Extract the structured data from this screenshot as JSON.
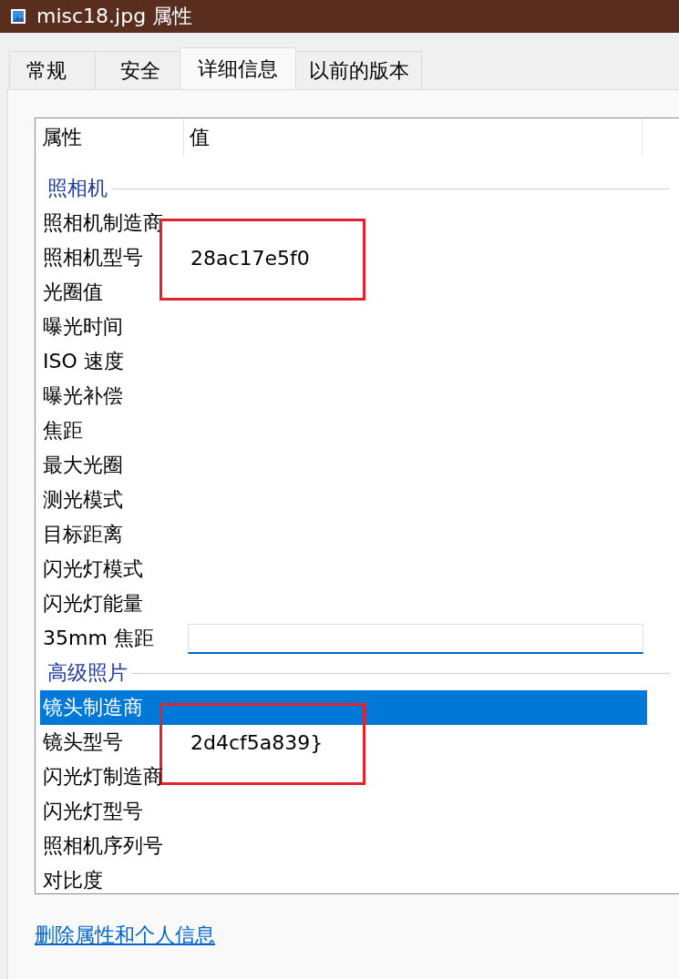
{
  "window": {
    "title": "misc18.jpg 属性"
  },
  "tabs": [
    {
      "label": "常规",
      "selected": false
    },
    {
      "label": "安全",
      "selected": false
    },
    {
      "label": "详细信息",
      "selected": true
    },
    {
      "label": "以前的版本",
      "selected": false
    }
  ],
  "list": {
    "columns": [
      "属性",
      "值"
    ],
    "rows": [
      {
        "kind": "group",
        "label": "照相机"
      },
      {
        "kind": "property",
        "name": "照相机制造商",
        "selected": false
      },
      {
        "kind": "property",
        "name": "照相机型号",
        "value": "28ac17e5f0",
        "selected": false,
        "highlighted": true
      },
      {
        "kind": "property",
        "name": "光圈值",
        "selected": false
      },
      {
        "kind": "property",
        "name": "曝光时间",
        "selected": false
      },
      {
        "kind": "property",
        "name": "ISO 速度",
        "selected": false
      },
      {
        "kind": "property",
        "name": "曝光补偿",
        "selected": false
      },
      {
        "kind": "property",
        "name": "焦距",
        "selected": false
      },
      {
        "kind": "property",
        "name": "最大光圈",
        "selected": false
      },
      {
        "kind": "property",
        "name": "测光模式",
        "selected": false
      },
      {
        "kind": "property",
        "name": "目标距离",
        "selected": false
      },
      {
        "kind": "property",
        "name": "闪光灯模式",
        "selected": false
      },
      {
        "kind": "property",
        "name": "闪光灯能量",
        "selected": false
      },
      {
        "kind": "property",
        "name": "35mm 焦距",
        "selected": false,
        "editing": true
      },
      {
        "kind": "group",
        "label": "高级照片"
      },
      {
        "kind": "property",
        "name": "镜头制造商",
        "selected": true
      },
      {
        "kind": "property",
        "name": "镜头型号",
        "value": "2d4cf5a839}",
        "selected": false,
        "highlighted": true
      },
      {
        "kind": "property",
        "name": "闪光灯制造商",
        "selected": false
      },
      {
        "kind": "property",
        "name": "闪光灯型号",
        "selected": false
      },
      {
        "kind": "property",
        "name": "照相机序列号",
        "selected": false
      },
      {
        "kind": "property",
        "name": "对比度",
        "selected": false
      }
    ]
  },
  "link": "删除属性和个人信息"
}
